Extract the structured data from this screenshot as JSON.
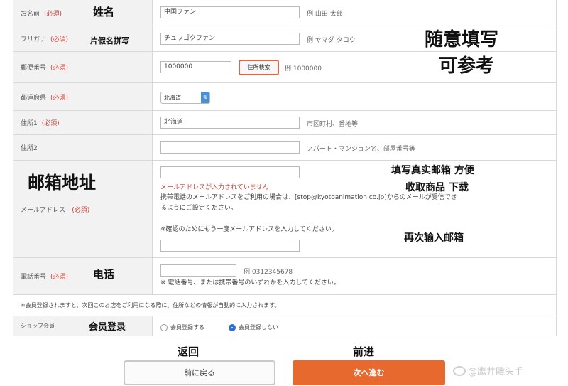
{
  "form": {
    "name": {
      "label": "お名前",
      "required": "(必須)",
      "value": "中国ファン",
      "example": "例 山田 太郎",
      "annotation": "姓名"
    },
    "furigana": {
      "label": "フリガナ",
      "required": "(必須)",
      "value": "チュウゴクファン",
      "example": "例 ヤマダ タロウ",
      "annotation": "片假名拼写"
    },
    "postal": {
      "label": "郵便番号",
      "required": "(必須)",
      "value": "1000000",
      "button": "住所検索",
      "example": "例 1000000"
    },
    "prefecture": {
      "label": "都道府県",
      "required": "(必須)",
      "value": "北海道"
    },
    "address1": {
      "label": "住所1",
      "required": "(必須)",
      "value": "北海道",
      "example": "市区町村、番地等"
    },
    "address2": {
      "label": "住所2",
      "value": "",
      "example": "アパート・マンション名、部屋番号等"
    },
    "email": {
      "label": "メールアドレス",
      "required": "(必須)",
      "value": "",
      "error": "メールアドレスが入力されていません",
      "note_line1": "携帯電話のメールアドレスをご利用の場合は、[stop@kyotoanimation.co.jp]からのメールが受信でき",
      "note_line2": "るようにご設定ください。",
      "confirm_note": "※確認のためにもう一度メールアドレスを入力してください。",
      "confirm_value": "",
      "annotation": "邮箱地址",
      "annotation_true_line1": "填写真实邮箱 方便",
      "annotation_true_line2": "收取商品 下载",
      "annotation_confirm": "再次输入邮箱"
    },
    "phone": {
      "label": "電話番号",
      "required": "(必須)",
      "value": "",
      "example": "例 0312345678",
      "note": "※ 電話番号、または携帯番号のいずれかを入力してください。",
      "annotation": "电话"
    },
    "member_note": "※会員登録されますと、次回このお店をご利用になる際に、住所などの情報が自動的に入力されます。",
    "shop_member": {
      "label": "ショップ会員",
      "option_register": "会員登録する",
      "option_no_register": "会員登録しない",
      "annotation": "会员登录"
    }
  },
  "annotations": {
    "free_fill_line1": "随意填写",
    "free_fill_line2": "可参考",
    "back": "返回",
    "next": "前进"
  },
  "buttons": {
    "back": "前に戻る",
    "next": "次へ進む"
  },
  "watermark": "@鹰井雕头手"
}
